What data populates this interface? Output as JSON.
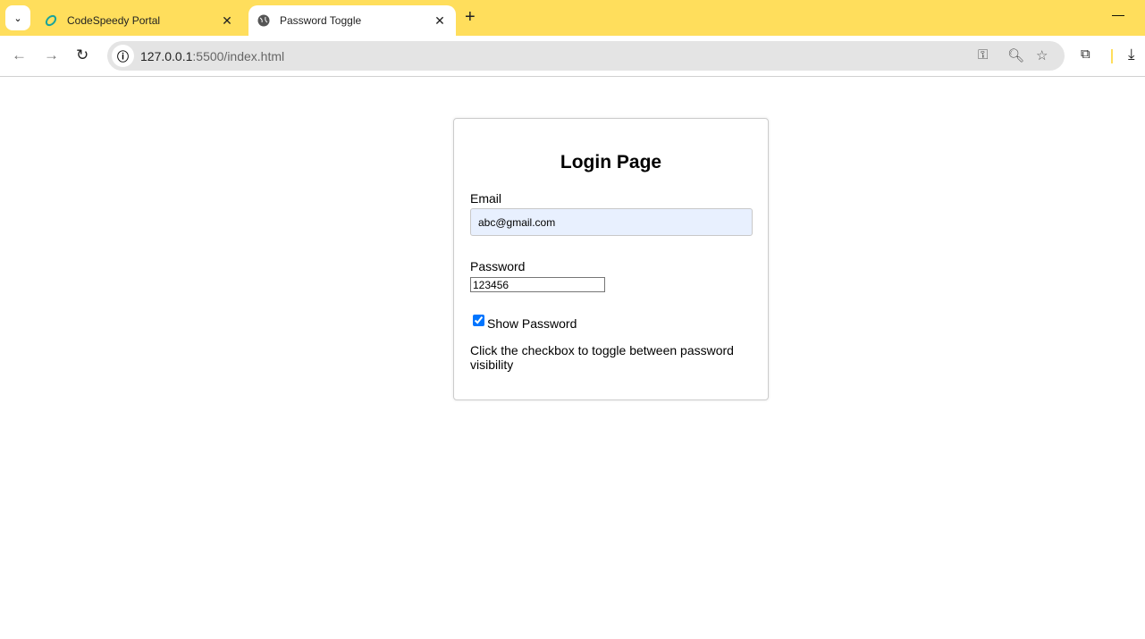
{
  "browser": {
    "tabs": [
      {
        "title": "CodeSpeedy Portal",
        "icon": "codespeedy-logo-icon",
        "active": false
      },
      {
        "title": "Password Toggle",
        "icon": "globe-icon",
        "active": true
      }
    ],
    "url_host": "127.0.0.1",
    "url_rest": ":5500/index.html",
    "accent": "#ffde5c"
  },
  "page": {
    "title": "Login Page",
    "email_label": "Email",
    "email_value": "abc@gmail.com",
    "password_label": "Password",
    "password_value": "123456",
    "show_password_label": "Show Password",
    "show_password_checked": true,
    "help_text": "Click the checkbox to toggle between password visibility"
  }
}
